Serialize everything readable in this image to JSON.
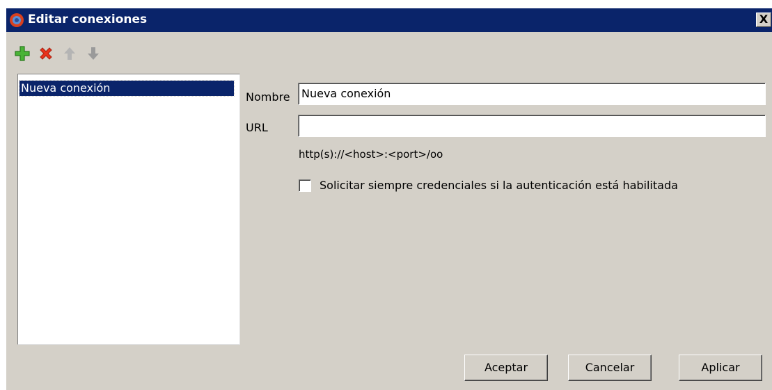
{
  "window": {
    "title": "Editar conexiones",
    "close_label": "X"
  },
  "toolbar": {
    "items": [
      {
        "icon": "plus-icon",
        "color": "#3aa52a",
        "enabled": true
      },
      {
        "icon": "delete-x-icon",
        "color": "#e02010",
        "enabled": true
      },
      {
        "icon": "arrow-up-icon",
        "color": "#a8a8a8",
        "enabled": false
      },
      {
        "icon": "arrow-down-icon",
        "color": "#909090",
        "enabled": false
      }
    ]
  },
  "connections": {
    "items": [
      {
        "label": "Nueva conexión",
        "selected": true
      }
    ]
  },
  "form": {
    "name_label": "Nombre",
    "name_value": "Nueva conexión",
    "url_label": "URL",
    "url_value": "",
    "url_hint": "http(s)://<host>:<port>/oo",
    "always_ask_label": "Solicitar siempre credenciales si la autenticación está habilitada",
    "always_ask_checked": false
  },
  "buttons": {
    "accept": "Aceptar",
    "cancel": "Cancelar",
    "apply": "Aplicar"
  },
  "colors": {
    "titlebar": "#0a246a",
    "face": "#d4d0c8",
    "selection": "#0a246a"
  }
}
